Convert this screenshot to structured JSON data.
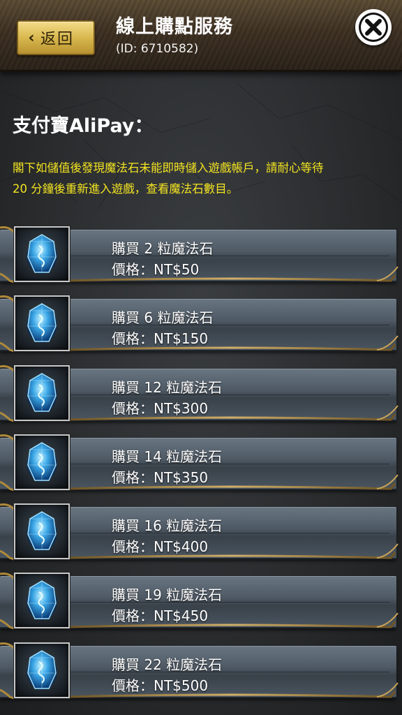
{
  "header": {
    "back_label": "返回",
    "title": "線上購點服務",
    "user_id": "(ID: 6710582)"
  },
  "section": {
    "title": "支付寶AliPay：",
    "notice_line1": "閣下如儲值後發現魔法石未能即時儲入遊戲帳戶，請耐心等待",
    "notice_line2": "20 分鐘後重新進入遊戲，查看魔法石數目。"
  },
  "products": [
    {
      "name": "購買 2 粒魔法石",
      "price": "價格：NT$50"
    },
    {
      "name": "購買 6 粒魔法石",
      "price": "價格：NT$150"
    },
    {
      "name": "購買 12 粒魔法石",
      "price": "價格：NT$300"
    },
    {
      "name": "購買 14 粒魔法石",
      "price": "價格：NT$350"
    },
    {
      "name": "購買 16 粒魔法石",
      "price": "價格：NT$400"
    },
    {
      "name": "購買 19 粒魔法石",
      "price": "價格：NT$450"
    },
    {
      "name": "購買 22 粒魔法石",
      "price": "價格：NT$500"
    }
  ],
  "icons": {
    "back": "chevron-left-icon",
    "close": "close-icon",
    "gem": "magic-stone-icon"
  },
  "colors": {
    "notice_text": "#f3e421",
    "back_button": "#d9b84f",
    "row_bar": "#4e5964",
    "gold_trim": "#b08a3a"
  }
}
